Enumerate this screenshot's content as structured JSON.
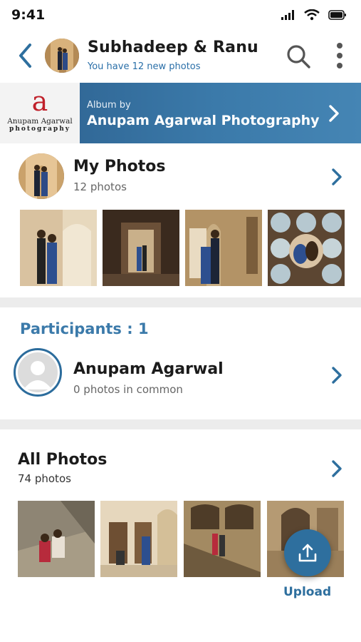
{
  "status": {
    "time": "9:41"
  },
  "header": {
    "title": "Subhadeep & Ranu",
    "subtitle": "You have 12 new photos"
  },
  "album": {
    "logo_letter": "a",
    "logo_name": "Anupam Agarwal",
    "logo_tag": "photography",
    "by_label": "Album by",
    "name": "Anupam Agarwal Photography"
  },
  "my_photos": {
    "title": "My Photos",
    "count": "12 photos"
  },
  "participants": {
    "label": "Participants : 1",
    "items": [
      {
        "name": "Anupam Agarwal",
        "common": "0 photos in common"
      }
    ]
  },
  "all_photos": {
    "title": "All Photos",
    "count": "74 photos"
  },
  "upload": {
    "label": "Upload"
  },
  "colors": {
    "accent": "#2e6f9e",
    "banner": "#3b7aaa",
    "divider": "#ececec"
  }
}
